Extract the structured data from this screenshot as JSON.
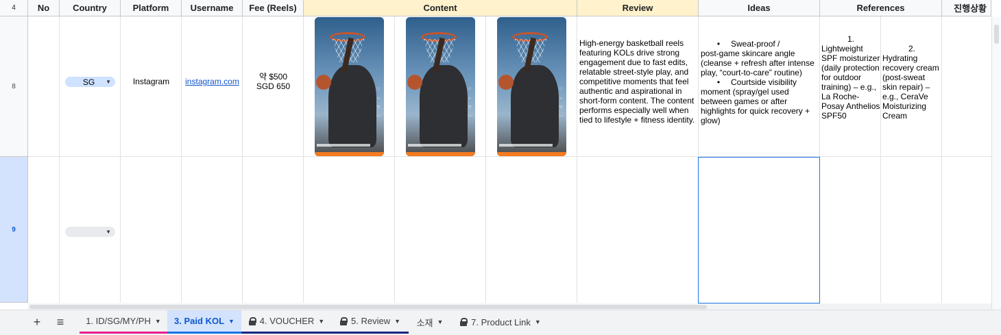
{
  "header": {
    "row_label": "4",
    "columns": [
      "No",
      "Country",
      "Platform",
      "Username",
      "Fee (Reels)",
      "Content",
      "Review",
      "Ideas",
      "References",
      "진행상황"
    ]
  },
  "rows": [
    {
      "row_num": "8",
      "country": "SG",
      "platform": "Instagram",
      "username": "instagram.com",
      "fee_line1": "약 $500",
      "fee_line2": "SGD 650",
      "review": "High-energy basketball reels featuring KOLs drive strong engagement due to fast edits, relatable street-style play, and competitive moments that feel authentic and aspirational in short-form content. The content performs especially well when tied to lifestyle + fitness identity.",
      "ideas": [
        {
          "bullet": "•",
          "line1": "Sweat-proof /",
          "rest": "post-game skincare angle (cleanse + refresh after intense play, “court-to-care” routine)"
        },
        {
          "bullet": "•",
          "line1": "Courtside visibility",
          "rest": "moment (spray/gel used between games or after highlights for quick recovery + glow)"
        }
      ],
      "ref1_num": "1.",
      "ref1": "Lightweight SPF moisturizer (daily protection for outdoor training) – e.g., La Roche-Posay Anthelios SPF50",
      "ref2_num": "2.",
      "ref2": "Hydrating recovery cream (post-sweat skin repair) – e.g., CeraVe Moisturizing Cream"
    },
    {
      "row_num": "9",
      "country": ""
    }
  ],
  "tabs": [
    {
      "label": "1. ID/SG/MY/PH",
      "locked": false,
      "active": false,
      "underline": "#e91e8c"
    },
    {
      "label": "3. Paid KOL",
      "locked": false,
      "active": true,
      "underline": "#1a73e8"
    },
    {
      "label": "4. VOUCHER",
      "locked": true,
      "active": false,
      "underline": "#1a237e"
    },
    {
      "label": "5. Review",
      "locked": true,
      "active": false,
      "underline": "#1a237e"
    },
    {
      "label": "소재",
      "locked": false,
      "active": false,
      "underline": ""
    },
    {
      "label": "7. Product Link",
      "locked": true,
      "active": false,
      "underline": ""
    }
  ],
  "toolbar": {
    "add_label": "+",
    "menu_label": "≡"
  },
  "colors": {
    "chip_sg": "#cfe2ff",
    "chip_empty": "#e8eaed",
    "content_header": "#fff2cc",
    "selection": "#1a73e8"
  }
}
